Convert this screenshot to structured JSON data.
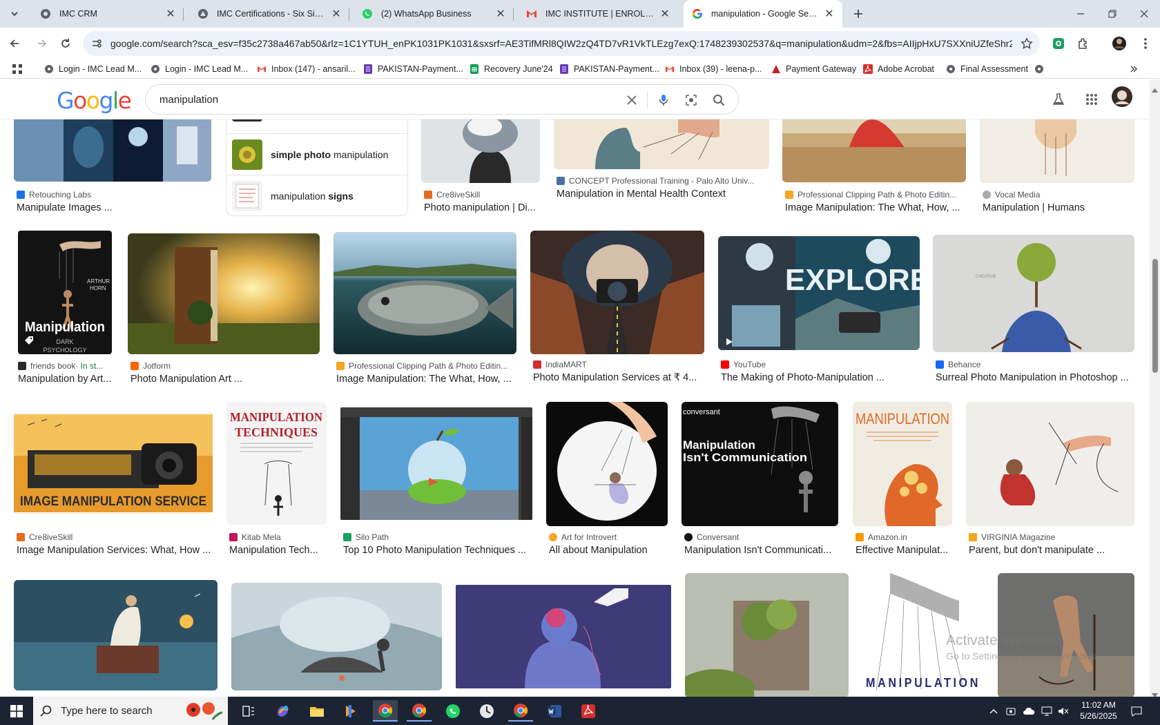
{
  "tabs": [
    {
      "title": "IMC CRM"
    },
    {
      "title": "IMC Certifications - Six Sigma Certifications"
    },
    {
      "title": "(2) WhatsApp Business"
    },
    {
      "title": "IMC INSTITUTE | ENROLLMENT"
    },
    {
      "title": "manipulation - Google Search"
    }
  ],
  "omnibox": {
    "url": "google.com/search?sca_esv=f35c2738a467ab50&rlz=1C1YTUH_enPK1031PK1031&sxsrf=AE3TifMRl8QIW2zQ4TD7vR1VkTLEzg7exQ:1748239302537&q=manipulation&udm=2&fbs=AIIjpHxU7SXXniUZfeShr2fp4..."
  },
  "bookmarks": [
    {
      "label": "Login - IMC Lead M..."
    },
    {
      "label": "Login - IMC Lead M..."
    },
    {
      "label": "Inbox (147) - ansaril..."
    },
    {
      "label": "PAKISTAN-Payment..."
    },
    {
      "label": "Recovery June'24"
    },
    {
      "label": "PAKISTAN-Payment..."
    },
    {
      "label": "Inbox (39) - leena-p..."
    },
    {
      "label": "Payment Gateway"
    },
    {
      "label": "Adobe Acrobat"
    },
    {
      "label": "Final Assessment"
    }
  ],
  "search": {
    "query": "manipulation"
  },
  "logo": {
    "letters": [
      "G",
      "o",
      "o",
      "g",
      "l",
      "e"
    ]
  },
  "suggestions": [
    {
      "bold": "simple photo",
      "rest": " manipulation"
    },
    {
      "pre": "manipulation ",
      "bold": "signs"
    }
  ],
  "results": {
    "row1": [
      {
        "source": "Retouching Labs",
        "caption": "Manipulate Images ..."
      },
      {
        "source": "Cre8iveSkill",
        "caption": "Photo manipulation | Di..."
      },
      {
        "source": "CONCEPT Professional Training - Palo Alto Univ...",
        "caption": "Manipulation in Mental Health Context"
      },
      {
        "source": "Professional Clipping Path & Photo Editin...",
        "caption": "Image Manipulation: The What, How, ..."
      },
      {
        "source": "Vocal Media",
        "caption": "Manipulation | Humans"
      }
    ],
    "row2": [
      {
        "source": "friends book",
        "source_extra": " · In st...",
        "caption": "Manipulation by Art...",
        "img_text": [
          "ARTHUR",
          "HORN",
          "Manipulation",
          "DARK",
          "PSYCHOLOGY"
        ]
      },
      {
        "source": "Jotform",
        "caption": "Photo Manipulation Art ..."
      },
      {
        "source": "Professional Clipping Path & Photo Editin...",
        "caption": "Image Manipulation: The What, How, ..."
      },
      {
        "source": "IndiaMART",
        "caption": "Photo Manipulation Services at ₹ 4..."
      },
      {
        "source": "YouTube",
        "caption": "The Making of Photo-Manipulation ...",
        "img_text": "EXPLORE"
      },
      {
        "source": "Behance",
        "caption": "Surreal Photo Manipulation in Photoshop ...",
        "img_text": "CREATIVE"
      }
    ],
    "row3": [
      {
        "source": "Cre8iveSkill",
        "caption": "Image Manipulation Services: What, How ...",
        "img_text": "IMAGE MANIPULATION SERVICE"
      },
      {
        "source": "Kitab Mela",
        "caption": "Manipulation Tech...",
        "img_text": [
          "MANIPULATION",
          "TECHNIQUES"
        ]
      },
      {
        "source": "Silo Path",
        "caption": "Top 10 Photo Manipulation Techniques ..."
      },
      {
        "source": "Art for Introvert",
        "caption": "All about Manipulation"
      },
      {
        "source": "Conversant",
        "caption": "Manipulation Isn't Communicati...",
        "img_text": [
          "conversant",
          "Manipulation",
          "Isn't Communication"
        ]
      },
      {
        "source": "Amazon.in",
        "caption": "Effective Manipulat...",
        "img_text": "MANIPULATION"
      },
      {
        "source": "VIRGINIA Magazine",
        "caption": "Parent, but don't manipulate ..."
      }
    ],
    "row4_img_text": "MANIPULATION"
  },
  "watermark": {
    "title": "Activate Windows",
    "subtitle": "Go to Settings to activate Windows."
  },
  "taskbar": {
    "search_placeholder": "Type here to search",
    "time": "11:02 AM",
    "date": "5/26/2025"
  },
  "colors": {
    "tabstrip": "#dde3ea",
    "omnibox": "#edf2fa",
    "taskbar": "#1c2433",
    "google_blue": "#4285f4",
    "google_red": "#ea4335",
    "google_yellow": "#fbbc05",
    "google_green": "#34a853"
  }
}
